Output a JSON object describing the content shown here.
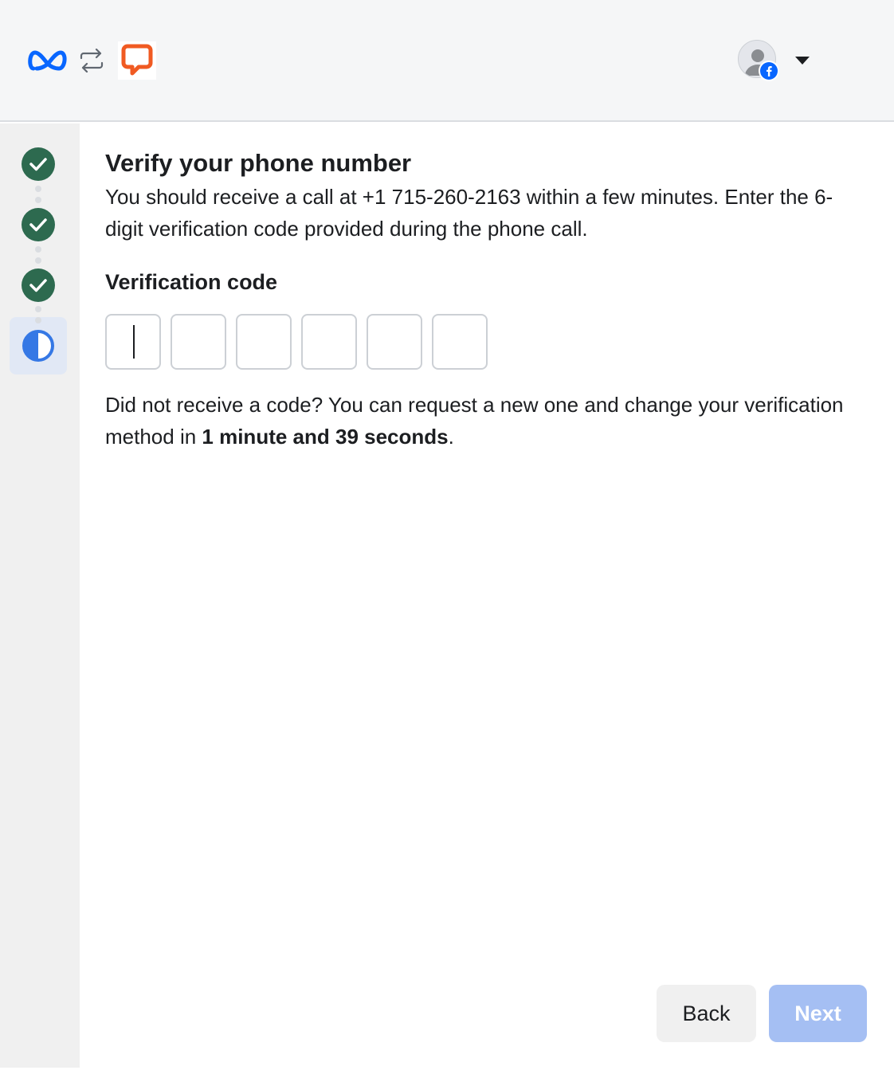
{
  "header": {
    "meta_logo": "meta-logo",
    "swap_icon": "swap-arrows-icon",
    "app_logo": "chat-bubble-logo",
    "account_avatar": "default-avatar",
    "account_badge": "facebook-icon",
    "account_menu_icon": "caret-down-icon"
  },
  "steps": [
    {
      "status": "complete",
      "icon": "check-circle-icon"
    },
    {
      "status": "complete",
      "icon": "check-circle-icon"
    },
    {
      "status": "complete",
      "icon": "check-circle-icon"
    },
    {
      "status": "in-progress",
      "icon": "half-circle-icon"
    }
  ],
  "main": {
    "title": "Verify your phone number",
    "description": "You should receive a call at +1 715-260-2163 within a few minutes. Enter the 6-digit verification code provided during the phone call.",
    "code_label": "Verification code",
    "code_digits": [
      "",
      "",
      "",
      "",
      "",
      ""
    ],
    "resend_prefix": "Did not receive a code? You can request a new one and change your verification method in ",
    "resend_time": "1 minute and 39 seconds",
    "resend_suffix": "."
  },
  "footer": {
    "back_label": "Back",
    "next_label": "Next"
  },
  "colors": {
    "step_complete": "#2d6a4f",
    "step_active": "#3578e5",
    "next_disabled": "#a5bff3",
    "meta_blue": "#0866ff",
    "app_orange": "#f05a22"
  }
}
